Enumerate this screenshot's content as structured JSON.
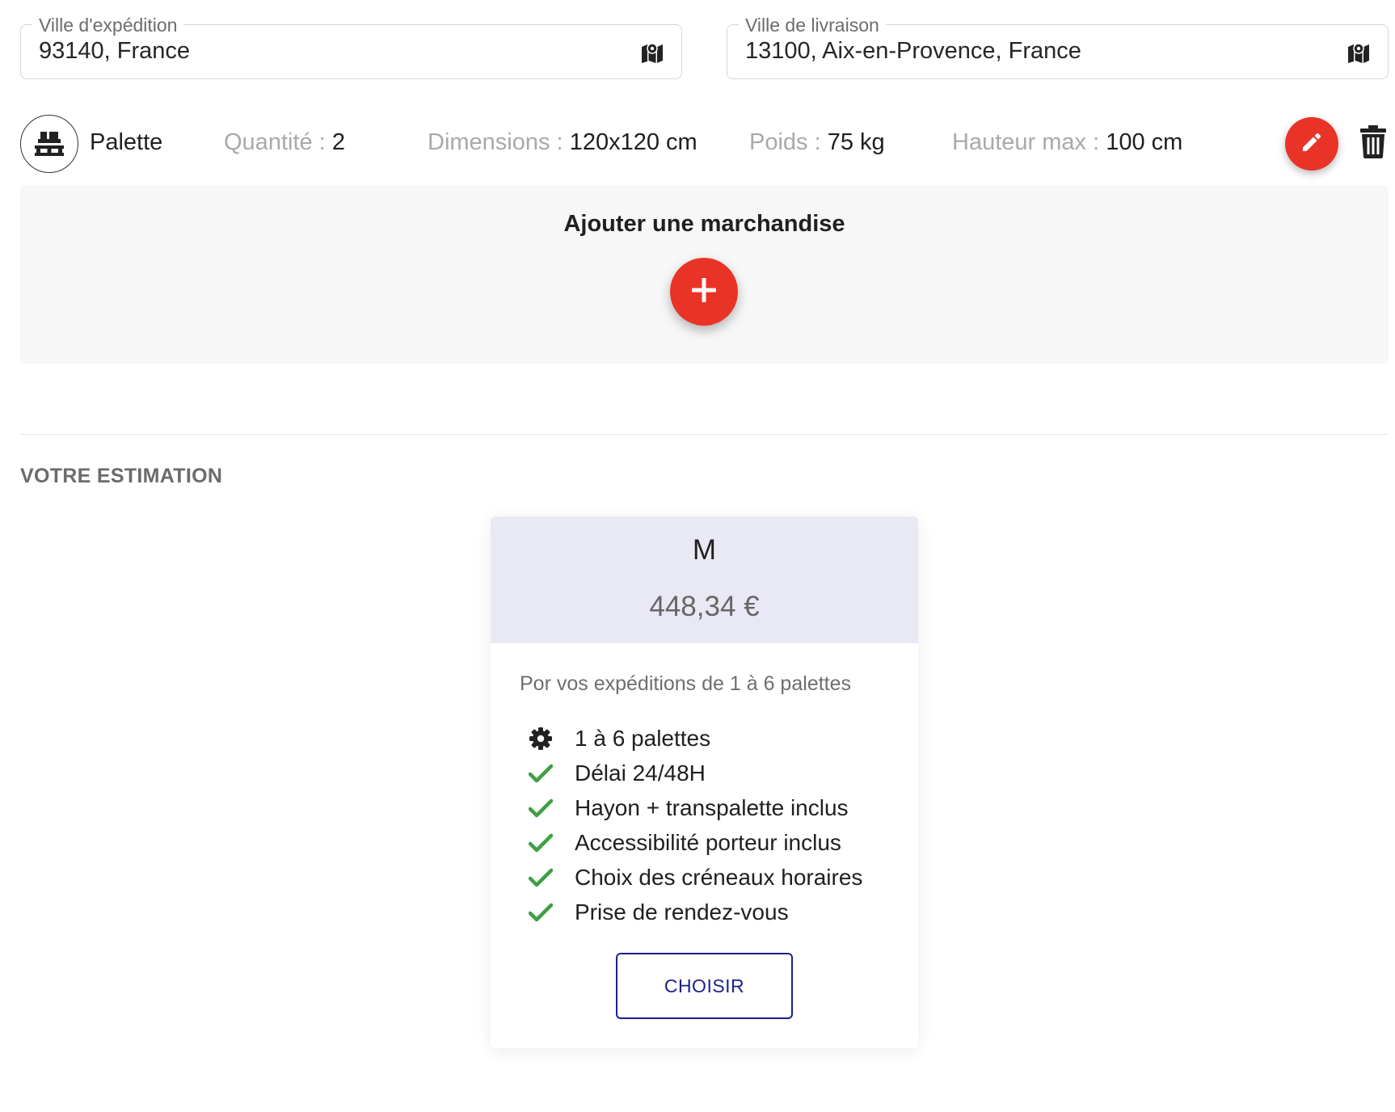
{
  "origin": {
    "label": "Ville d'expédition",
    "value": "93140, France",
    "icon": "map-icon"
  },
  "destination": {
    "label": "Ville de livraison",
    "value": "13100, Aix-en-Provence, France",
    "icon": "map-icon"
  },
  "goods": {
    "type": "Palette",
    "icon": "pallet-icon",
    "quantity_label": "Quantité :",
    "quantity_value": "2",
    "dimensions_label": "Dimensions :",
    "dimensions_value": "120x120 cm",
    "weight_label": "Poids :",
    "weight_value": "75 kg",
    "height_label": "Hauteur max :",
    "height_value": "100 cm",
    "edit_icon": "pencil-icon",
    "delete_icon": "trash-icon"
  },
  "add_goods": {
    "title": "Ajouter une marchandise",
    "icon": "plus-icon"
  },
  "estimation": {
    "section_title": "VOTRE ESTIMATION",
    "plan": {
      "name": "M",
      "price": "448,34 €",
      "subtitle": "Por vos expéditions de 1 à 6 palettes",
      "features": [
        {
          "icon": "gear-icon",
          "text": "1 à 6 palettes"
        },
        {
          "icon": "check-icon",
          "text": "Délai 24/48H"
        },
        {
          "icon": "check-icon",
          "text": "Hayon + transpalette inclus"
        },
        {
          "icon": "check-icon",
          "text": "Accessibilité porteur inclus"
        },
        {
          "icon": "check-icon",
          "text": "Choix des créneaux horaires"
        },
        {
          "icon": "check-icon",
          "text": "Prise de rendez-vous"
        }
      ],
      "button_label": "CHOISIR"
    }
  },
  "colors": {
    "accent_red": "#e93326",
    "check_green": "#3ea043",
    "button_blue": "#1c1f8f",
    "card_header_bg": "#e9e9f5"
  }
}
